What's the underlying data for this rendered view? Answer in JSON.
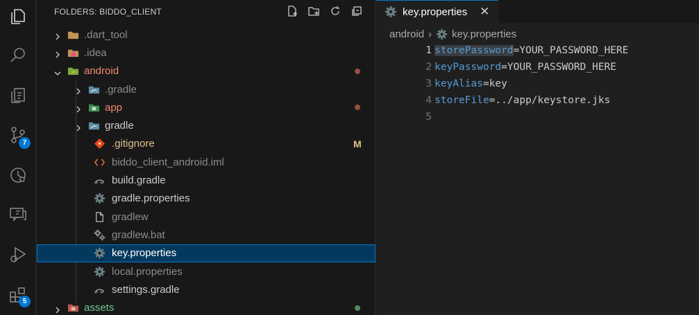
{
  "activity_bar": {
    "items": [
      {
        "icon": "explorer-icon"
      },
      {
        "icon": "search-icon"
      },
      {
        "icon": "testing-icon"
      },
      {
        "icon": "source-control-icon",
        "badge": "7"
      },
      {
        "icon": "timeline-icon"
      },
      {
        "icon": "chat-icon"
      },
      {
        "icon": "run-debug-icon"
      },
      {
        "icon": "extensions-icon",
        "badge": "5"
      }
    ]
  },
  "sidebar": {
    "title": "FOLDERS: BIDDO_CLIENT",
    "actions": [
      "new-file-icon",
      "new-folder-icon",
      "refresh-icon",
      "collapse-all-icon"
    ],
    "tree": [
      {
        "label": ".dart_tool",
        "type": "folder",
        "depth": 0,
        "expanded": false,
        "icon": "folder-icon",
        "color": "#8c8c8c"
      },
      {
        "label": ".idea",
        "type": "folder",
        "depth": 0,
        "expanded": false,
        "icon": "idea-folder-icon",
        "color": "#8c8c8c"
      },
      {
        "label": "android",
        "type": "folder",
        "depth": 0,
        "expanded": true,
        "icon": "android-folder-icon",
        "color": "#f48771",
        "decoration": "dot",
        "decoration_color": "#9b4e42"
      },
      {
        "label": ".gradle",
        "type": "folder",
        "depth": 1,
        "expanded": false,
        "icon": "gradle-folder-icon",
        "color": "#8c8c8c"
      },
      {
        "label": "app",
        "type": "folder",
        "depth": 1,
        "expanded": false,
        "icon": "app-folder-icon",
        "color": "#f48771",
        "decoration": "dot",
        "decoration_color": "#9b4e42"
      },
      {
        "label": "gradle",
        "type": "folder",
        "depth": 1,
        "expanded": false,
        "icon": "gradle-folder-icon",
        "color": "#cccccc"
      },
      {
        "label": ".gitignore",
        "type": "file",
        "depth": 1,
        "icon": "git-icon",
        "color": "#e2c08d",
        "decoration": "M"
      },
      {
        "label": "biddo_client_android.iml",
        "type": "file",
        "depth": 1,
        "icon": "xml-icon",
        "color": "#8c8c8c"
      },
      {
        "label": "build.gradle",
        "type": "file",
        "depth": 1,
        "icon": "gradle-icon",
        "color": "#cccccc"
      },
      {
        "label": "gradle.properties",
        "type": "file",
        "depth": 1,
        "icon": "gear-icon",
        "color": "#cccccc"
      },
      {
        "label": "gradlew",
        "type": "file",
        "depth": 1,
        "icon": "file-icon",
        "color": "#8c8c8c"
      },
      {
        "label": "gradlew.bat",
        "type": "file",
        "depth": 1,
        "icon": "gears-icon",
        "color": "#8c8c8c"
      },
      {
        "label": "key.properties",
        "type": "file",
        "depth": 1,
        "icon": "gear-icon",
        "color": "#ffffff",
        "selected": true
      },
      {
        "label": "local.properties",
        "type": "file",
        "depth": 1,
        "icon": "gear-icon",
        "color": "#8c8c8c"
      },
      {
        "label": "settings.gradle",
        "type": "file",
        "depth": 1,
        "icon": "gradle-icon",
        "color": "#cccccc"
      },
      {
        "label": "assets",
        "type": "folder",
        "depth": 0,
        "expanded": false,
        "icon": "assets-folder-icon",
        "color": "#73c991",
        "decoration": "dot",
        "decoration_color": "#4e8a5f"
      }
    ]
  },
  "editor": {
    "tab": {
      "label": "key.properties",
      "close": "✕"
    },
    "breadcrumb": {
      "folder": "android",
      "separator": "›",
      "file": "key.properties"
    },
    "lines": [
      {
        "num": "1",
        "key": "storePassword",
        "value": "=YOUR_PASSWORD_HERE",
        "active": true
      },
      {
        "num": "2",
        "key": "keyPassword",
        "value": "=YOUR_PASSWORD_HERE"
      },
      {
        "num": "3",
        "key": "keyAlias",
        "value": "=key"
      },
      {
        "num": "4",
        "key": "storeFile",
        "value": "=../app/keystore.jks"
      },
      {
        "num": "5",
        "key": "",
        "value": ""
      }
    ]
  },
  "colors": {
    "accent": "#0078d4",
    "selection": "#04395e"
  }
}
